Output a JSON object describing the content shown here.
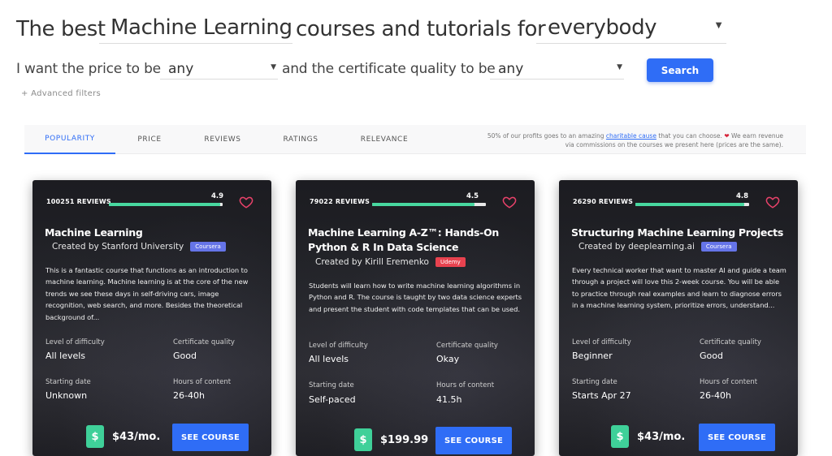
{
  "headline": {
    "prefix": "The best",
    "topic": "Machine Learning",
    "middle": "courses and tutorials for",
    "audience": "everybody"
  },
  "filters": {
    "price_prefix": "I want the price to be",
    "price_value": "any",
    "quality_prefix": "and the certificate quality to be",
    "quality_value": "any",
    "search_label": "Search",
    "advanced_label": "+ Advanced filters"
  },
  "sort_tabs": [
    "POPULARITY",
    "PRICE",
    "REVIEWS",
    "RATINGS",
    "RELEVANCE"
  ],
  "active_tab": "POPULARITY",
  "notice": {
    "pre": "50% of our profits goes to an amazing",
    "link": "charitable cause",
    "mid": "that you can choose.",
    "post": "We earn revenue",
    "line2": "via commissions on the courses we present here (prices are the same)."
  },
  "colors": {
    "accent": "#2f6df6",
    "rating_bar": "#48d8a0",
    "heart": "#e8426a",
    "coursera_badge": "#6574e8",
    "udemy_badge": "#e8424f"
  },
  "cards": [
    {
      "reviews": "100251 REVIEWS",
      "rating": "4.9",
      "rating_fraction": 0.98,
      "title": "Machine Learning",
      "creator": "Created by Stanford University",
      "platform": "Coursera",
      "description": "This is a fantastic course that functions as an introduction to machine learning. Machine learning is at the core of the new trends we see these days in self-driving cars, image recognition, web search, and more. Besides the theoretical background of...",
      "difficulty_label": "Level of difficulty",
      "difficulty": "All levels",
      "cert_label": "Certificate quality",
      "cert": "Good",
      "start_label": "Starting date",
      "start": "Unknown",
      "hours_label": "Hours of content",
      "hours": "26-40h",
      "price": "$43/mo.",
      "button": "SEE COURSE"
    },
    {
      "reviews": "79022 REVIEWS",
      "rating": "4.5",
      "rating_fraction": 0.9,
      "title": "Machine Learning A-Z™: Hands-On Python & R In Data Science",
      "creator": "Created by Kirill Eremenko",
      "platform": "Udemy",
      "description": "Students will learn how to write machine learning algorithms in Python and R. The course is taught by two data science experts and present the student with code templates that can be used.",
      "difficulty_label": "Level of difficulty",
      "difficulty": "All levels",
      "cert_label": "Certificate quality",
      "cert": "Okay",
      "start_label": "Starting date",
      "start": "Self-paced",
      "hours_label": "Hours of content",
      "hours": "41.5h",
      "price": "$199.99",
      "button": "SEE COURSE"
    },
    {
      "reviews": "26290 REVIEWS",
      "rating": "4.8",
      "rating_fraction": 0.96,
      "title": "Structuring Machine Learning Projects",
      "creator": "Created by deeplearning.ai",
      "platform": "Coursera",
      "description": "Every technical worker that want to master AI and guide a team through a project will love this 2-week course. You will be able to practice through real examples and learn to diagnose errors in a machine learning system, prioritize errors, understand...",
      "difficulty_label": "Level of difficulty",
      "difficulty": "Beginner",
      "cert_label": "Certificate quality",
      "cert": "Good",
      "start_label": "Starting date",
      "start": "Starts Apr 27",
      "hours_label": "Hours of content",
      "hours": "26-40h",
      "price": "$43/mo.",
      "button": "SEE COURSE"
    }
  ]
}
